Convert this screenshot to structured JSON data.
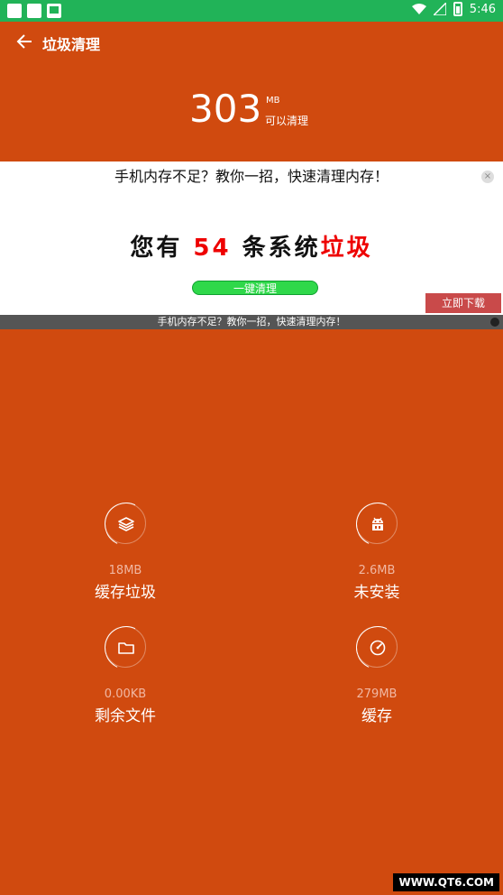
{
  "status_bar": {
    "time": "5:46"
  },
  "header": {
    "title": "垃圾清理",
    "size_value": "303",
    "size_unit": "MB",
    "size_desc": "可以清理"
  },
  "ad": {
    "top_text": "手机内存不足？教你一招，快速清理内存！",
    "headline_prefix": "您有",
    "headline_count": "54",
    "headline_mid": "条系统",
    "headline_suffix": "垃圾",
    "button_label": "一键清理",
    "download_label": "立即下载",
    "close_glyph": "×",
    "strip_text": "手机内存不足？教你一招，快速清理内存！"
  },
  "categories": [
    {
      "size": "18MB",
      "label": "缓存垃圾",
      "icon": "layers-icon"
    },
    {
      "size": "2.6MB",
      "label": "未安装",
      "icon": "android-icon"
    },
    {
      "size": "0.00KB",
      "label": "剩余文件",
      "icon": "folder-icon"
    },
    {
      "size": "279MB",
      "label": "缓存",
      "icon": "speedometer-icon"
    }
  ],
  "watermark": "WWW.QT6.COM",
  "colors": {
    "primary": "#d04a0f",
    "status_bar": "#21b358"
  }
}
